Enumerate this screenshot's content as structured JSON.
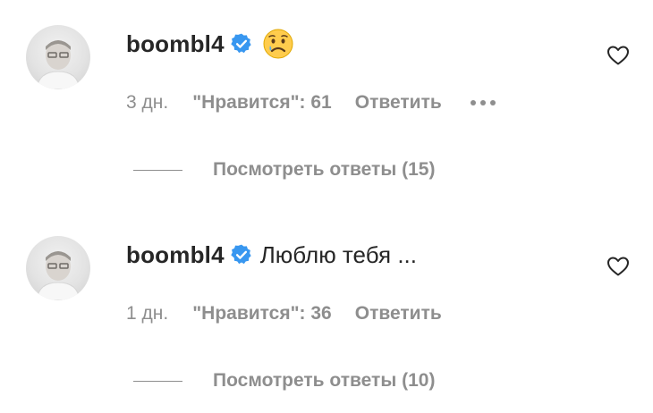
{
  "comments": [
    {
      "username": "boombl4",
      "text": "",
      "emoji": "sad-face-emoji",
      "time": "3 дн.",
      "likes": "\"Нравится\": 61",
      "reply": "Ответить",
      "view_replies": "Посмотреть ответы (15)"
    },
    {
      "username": "boombl4",
      "text": "Люблю тебя ...",
      "time": "1 дн.",
      "likes": "\"Нравится\": 36",
      "reply": "Ответить",
      "view_replies": "Посмотреть ответы (10)"
    }
  ],
  "colors": {
    "text_primary": "#262626",
    "text_secondary": "#8e8e8e",
    "verified_blue": "#3897f0",
    "emoji_yellow": "#ffcc4d",
    "background": "#ffffff"
  },
  "icons": {
    "verified": "verified-badge-icon",
    "like": "heart-outline-icon",
    "more": "more-options-icon"
  }
}
